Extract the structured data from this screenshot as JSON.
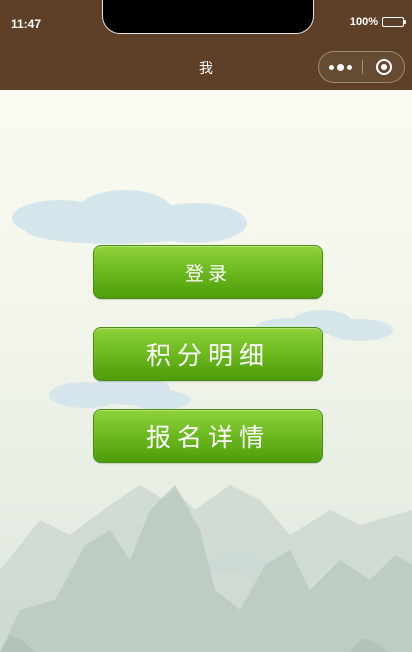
{
  "status_bar": {
    "time": "11:47",
    "battery": "100%"
  },
  "nav": {
    "title": "我"
  },
  "menu": {
    "login_label": "登录",
    "points_label": "积分明细",
    "signup_label": "报名详情"
  },
  "colors": {
    "nav_background": "#5d4027",
    "button_green": "#6fbb22"
  }
}
